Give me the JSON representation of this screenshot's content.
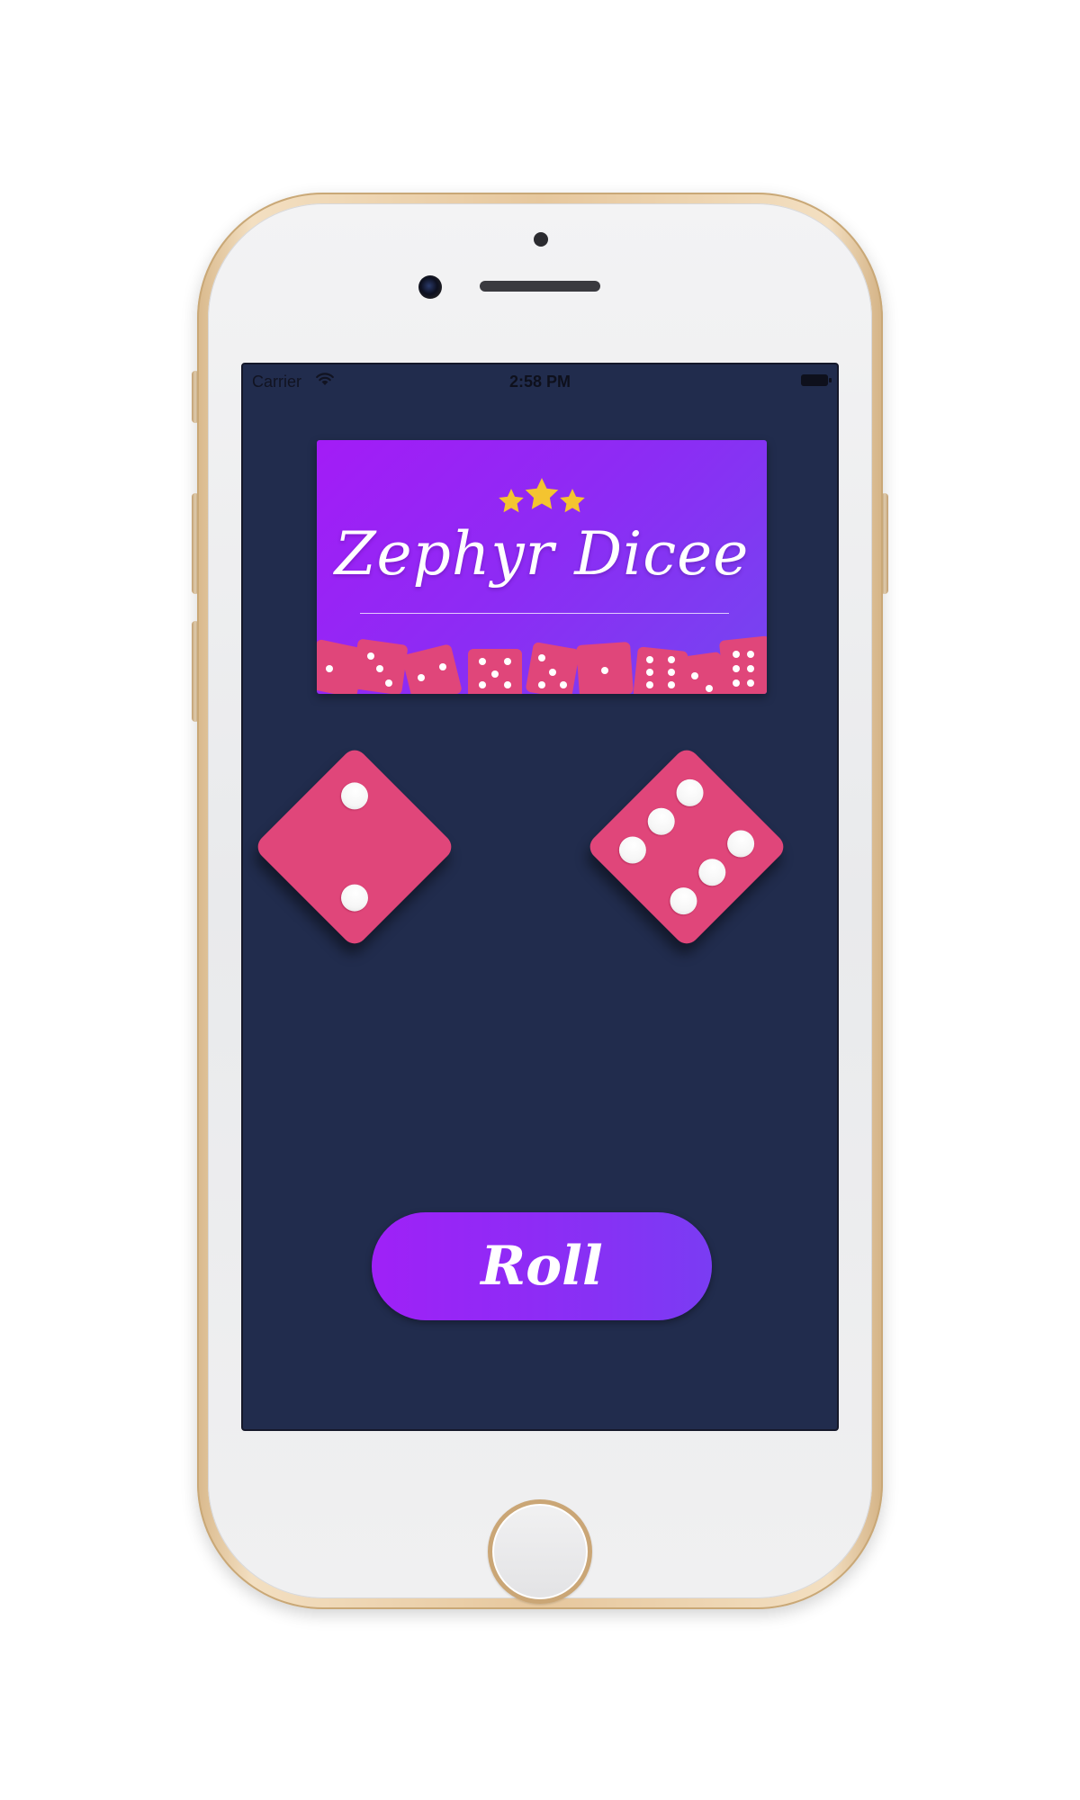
{
  "status_bar": {
    "carrier": "Carrier",
    "time": "2:58 PM"
  },
  "logo": {
    "title": "Zephyr Dicee",
    "star_count": 3
  },
  "dice": {
    "left_value": 2,
    "right_value": 6
  },
  "actions": {
    "roll_label": "Roll"
  },
  "colors": {
    "screen_background": "#212c4d",
    "die_face": "#e0467a",
    "pip": "#ffffff",
    "accent_purple": "#9f21f7",
    "star_gold": "#f4c430"
  },
  "icons": {
    "wifi": "wifi-icon",
    "battery": "battery-icon",
    "star": "star-icon"
  }
}
